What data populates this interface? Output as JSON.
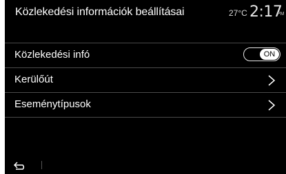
{
  "header": {
    "title": "Közlekedési információk beállításai",
    "temperature": "27°C",
    "time": "2:17",
    "time_suffix": "PM"
  },
  "settings": {
    "items": [
      {
        "label": "Közlekedési infó",
        "control": "toggle",
        "toggle_label": "ON",
        "enabled": true
      },
      {
        "label": "Kerülőút",
        "control": "chevron-right-icon"
      },
      {
        "label": "Eseménytípusok",
        "control": "chevron-right-icon"
      }
    ]
  },
  "footer": {
    "back_icon": "back-arrow-icon"
  }
}
